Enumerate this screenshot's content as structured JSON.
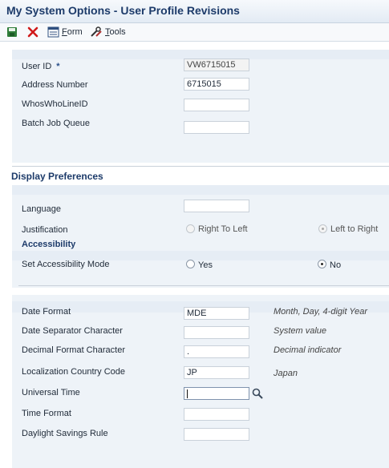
{
  "window": {
    "title": "My System Options - User Profile Revisions"
  },
  "toolbar": {
    "save_icon": "save-icon",
    "cancel_icon": "cancel-icon",
    "form_label_mn": "F",
    "form_label_rest": "orm",
    "tools_label_mn": "T",
    "tools_label_rest": "ools"
  },
  "identity": {
    "user_id_label": "User ID",
    "required_mark": "*",
    "user_id_value": "VW6715015",
    "address_number_label": "Address Number",
    "address_number_value": "6715015",
    "whos_who_label": "WhosWhoLineID",
    "whos_who_value": "",
    "batch_queue_label": "Batch Job Queue",
    "batch_queue_value": ""
  },
  "display": {
    "section_title": "Display Preferences",
    "language_label": "Language",
    "language_value": "",
    "justification_label": "Justification",
    "justification_options": [
      "Right To Left",
      "Left to Right"
    ],
    "justification_selected": "Left to Right",
    "accessibility_title": "Accessibility",
    "accessibility_label": "Set Accessibility Mode",
    "accessibility_options": [
      "Yes",
      "No"
    ],
    "accessibility_selected": "No"
  },
  "formats": {
    "date_format_label": "Date Format",
    "date_format_value": "MDE",
    "date_format_desc": "Month, Day, 4-digit Year",
    "date_sep_label": "Date Separator Character",
    "date_sep_value": "",
    "date_sep_desc": "System value",
    "decimal_label": "Decimal Format Character",
    "decimal_value": ".",
    "decimal_desc": "Decimal indicator",
    "country_label": "Localization Country Code",
    "country_value": "JP",
    "country_desc": "Japan",
    "universal_time_label": "Universal Time",
    "universal_time_value": "",
    "time_format_label": "Time Format",
    "time_format_value": "",
    "dst_label": "Daylight Savings Rule",
    "dst_value": ""
  },
  "colors": {
    "accent": "#1d3b6a",
    "panel": "#eef3f8",
    "marker": "#e87d1e"
  }
}
